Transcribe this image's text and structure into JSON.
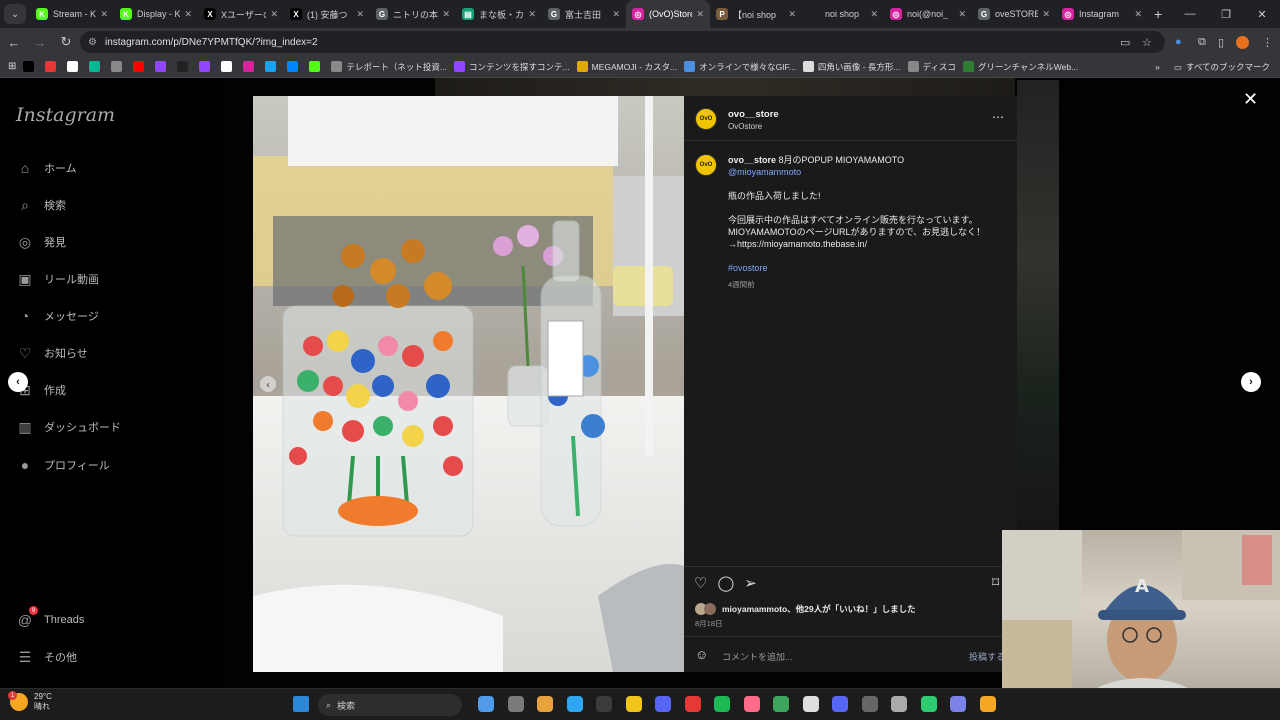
{
  "browser": {
    "tabs": [
      {
        "title": "Stream - K",
        "color": "#53fc18",
        "glyph": "K"
      },
      {
        "title": "Display - K",
        "color": "#53fc18",
        "glyph": "K"
      },
      {
        "title": "Xユーザーの",
        "color": "#000000",
        "glyph": "X"
      },
      {
        "title": "(1) 安藤つ",
        "color": "#000000",
        "glyph": "X"
      },
      {
        "title": "ニトリの本な",
        "color": "#5f6368",
        "glyph": "G"
      },
      {
        "title": "まな板・カッ",
        "color": "#1aa37a",
        "glyph": "▤"
      },
      {
        "title": "富士吉田",
        "color": "#5f6368",
        "glyph": "G"
      },
      {
        "title": "(OvO)Store",
        "color": "#d6249f",
        "glyph": "◎",
        "active": true
      },
      {
        "title": "【noi shop",
        "color": "#7a5b3a",
        "glyph": "P"
      },
      {
        "title": "noi shop",
        "color": "#202124",
        "glyph": ""
      },
      {
        "title": "noi(@noi_",
        "color": "#d6249f",
        "glyph": "◎"
      },
      {
        "title": "oveSTORE",
        "color": "#5f6368",
        "glyph": "G"
      },
      {
        "title": "Instagram",
        "color": "#d6249f",
        "glyph": "◎"
      }
    ],
    "url": "instagram.com/p/DNe7YPMTfQK/?img_index=2",
    "bookmarks": [
      {
        "label": "",
        "color": "#000000"
      },
      {
        "label": "",
        "color": "#e53935"
      },
      {
        "label": "",
        "color": "#ffffff"
      },
      {
        "label": "",
        "color": "#00b894"
      },
      {
        "label": "",
        "color": "#888888"
      },
      {
        "label": "",
        "color": "#ff0000"
      },
      {
        "label": "",
        "color": "#9146ff"
      },
      {
        "label": "",
        "color": "#222222"
      },
      {
        "label": "",
        "color": "#9146ff"
      },
      {
        "label": "",
        "color": "#ffffff"
      },
      {
        "label": "",
        "color": "#d6249f"
      },
      {
        "label": "",
        "color": "#1da1f2"
      },
      {
        "label": "",
        "color": "#0085ff"
      },
      {
        "label": "",
        "color": "#53fc18"
      },
      {
        "label": "テレポート（ネット投資...",
        "color": "#888888"
      },
      {
        "label": "コンテンツを探すコンテ...",
        "color": "#9146ff"
      },
      {
        "label": "MEGAMOJI - カスタ...",
        "color": "#e0a800"
      },
      {
        "label": "オンラインで様々なGIF...",
        "color": "#4a90e2"
      },
      {
        "label": "四角い画像 - 長方形...",
        "color": "#dddddd"
      },
      {
        "label": "ディスコ",
        "color": "#888888"
      },
      {
        "label": "グリーンチャンネルWeb...",
        "color": "#2e7d32"
      }
    ],
    "bookmarks_folder": "すべてのブックマーク"
  },
  "sidebar": {
    "logo": "Instagram",
    "items": [
      {
        "label": "ホーム",
        "icon": "⌂"
      },
      {
        "label": "検索",
        "icon": "⌕"
      },
      {
        "label": "発見",
        "icon": "◎"
      },
      {
        "label": "リール動画",
        "icon": "▣"
      },
      {
        "label": "メッセージ",
        "icon": "◔"
      },
      {
        "label": "お知らせ",
        "icon": "♡"
      },
      {
        "label": "作成",
        "icon": "⊞"
      },
      {
        "label": "ダッシュボード",
        "icon": "▥"
      },
      {
        "label": "プロフィール",
        "icon": "●"
      }
    ],
    "threads": "Threads",
    "threads_badge": "9",
    "more": "その他"
  },
  "post": {
    "username": "ovo__store",
    "subtitle": "OvOstore",
    "avatar_text": "OvO",
    "caption_user": "ovo__store",
    "caption_title": "8月のPOPUP MIOYAMAMOTO",
    "mention": "@mioyamammoto",
    "line1": "瓶の作品入荷しました!",
    "line2": "今回展示中の作品はすべてオンライン販売を行なっています。",
    "line3": "MIOYAMAMOTOのページURLがありますので、お見逃しなく！",
    "line4": "→https://mioyamamoto.thebase.in/",
    "hashtag": "#ovostore",
    "caption_time": "4週間前",
    "likes": "mioyamammoto、他29人が「いいね！」しました",
    "date": "8月18日",
    "comment_placeholder": "コメントを追加...",
    "post_button": "投稿する"
  },
  "taskbar": {
    "temp": "29°C",
    "weather": "晴れ",
    "weather_badge": "1",
    "search": "検索"
  }
}
